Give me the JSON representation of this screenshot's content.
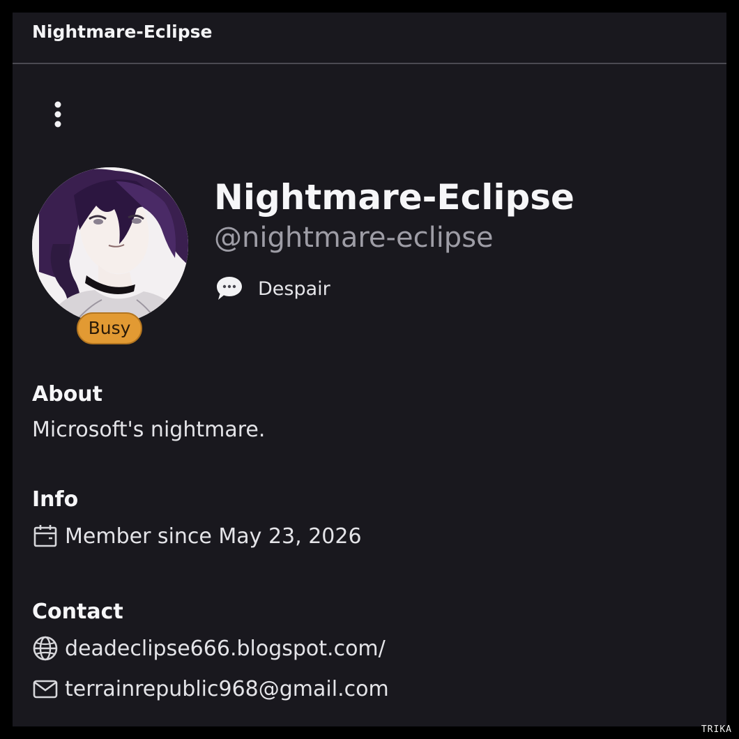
{
  "header": {
    "title": "Nightmare-Eclipse"
  },
  "menu": {
    "icon": "kebab-vertical-icon"
  },
  "profile": {
    "display_name": "Nightmare-Eclipse",
    "username": "@nightmare-eclipse",
    "presence_status": "Busy",
    "presence_color": "#e29a33",
    "custom_status_icon": "speech-bubble-icon",
    "custom_status": "Despair"
  },
  "about": {
    "heading": "About",
    "text": "Microsoft's nightmare."
  },
  "info": {
    "heading": "Info",
    "member_since_icon": "calendar-icon",
    "member_since": "Member since May 23, 2026"
  },
  "contact": {
    "heading": "Contact",
    "website_icon": "globe-icon",
    "website": "deadeclipse666.blogspot.com/",
    "email_icon": "mail-icon",
    "email": "terrainrepublic968@gmail.com"
  },
  "watermark": "TRIKA",
  "colors": {
    "background": "#19181e",
    "divider": "#4b4a52",
    "muted_text": "#9e9da6"
  }
}
